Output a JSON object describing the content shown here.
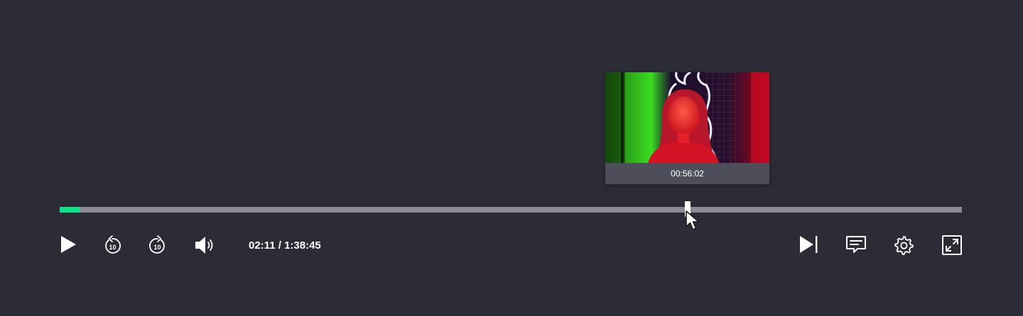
{
  "player": {
    "state": "paused",
    "colors": {
      "background": "#2c2c37",
      "accent": "#10e38a",
      "track": "#8a8a92",
      "tooltip": "#4e4e5a",
      "icon": "#ffffff"
    },
    "progress": {
      "played_fraction": 0.022,
      "hover_fraction": 0.696
    },
    "preview": {
      "time": "00:56:02",
      "thumbnail": "woman-in-red-light-with-neon-sign"
    },
    "time_display": {
      "current": "02:11",
      "separator": " / ",
      "duration": "1:38:45"
    },
    "controls": {
      "left": [
        "play-icon",
        "rewind-10-icon",
        "forward-10-icon",
        "volume-icon"
      ],
      "right": [
        "next-icon",
        "subtitles-icon",
        "settings-icon",
        "fullscreen-icon"
      ],
      "skip_seconds": "10"
    }
  }
}
